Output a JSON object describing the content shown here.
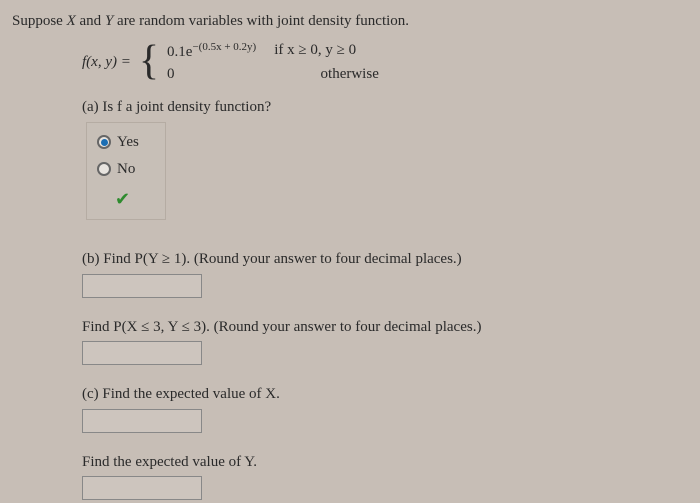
{
  "intro_prefix": "Suppose ",
  "intro_x": "X",
  "intro_mid": " and ",
  "intro_y": "Y",
  "intro_suffix": " are random variables with joint density function.",
  "formula": {
    "lhs": "f(x, y) = ",
    "case1_expr": "0.1e",
    "case1_exp": "−(0.5x + 0.2y)",
    "case1_cond": "if x ≥ 0, y ≥ 0",
    "case2_expr": "0",
    "case2_cond": "otherwise"
  },
  "part_a": {
    "question": "(a) Is f a joint density function?",
    "opt_yes": "Yes",
    "opt_no": "No"
  },
  "part_b1": "(b) Find P(Y ≥ 1). (Round your answer to four decimal places.)",
  "part_b2": "Find P(X ≤ 3, Y ≤ 3). (Round your answer to four decimal places.)",
  "part_c": "(c) Find the expected value of X.",
  "part_c2": "Find the expected value of Y."
}
